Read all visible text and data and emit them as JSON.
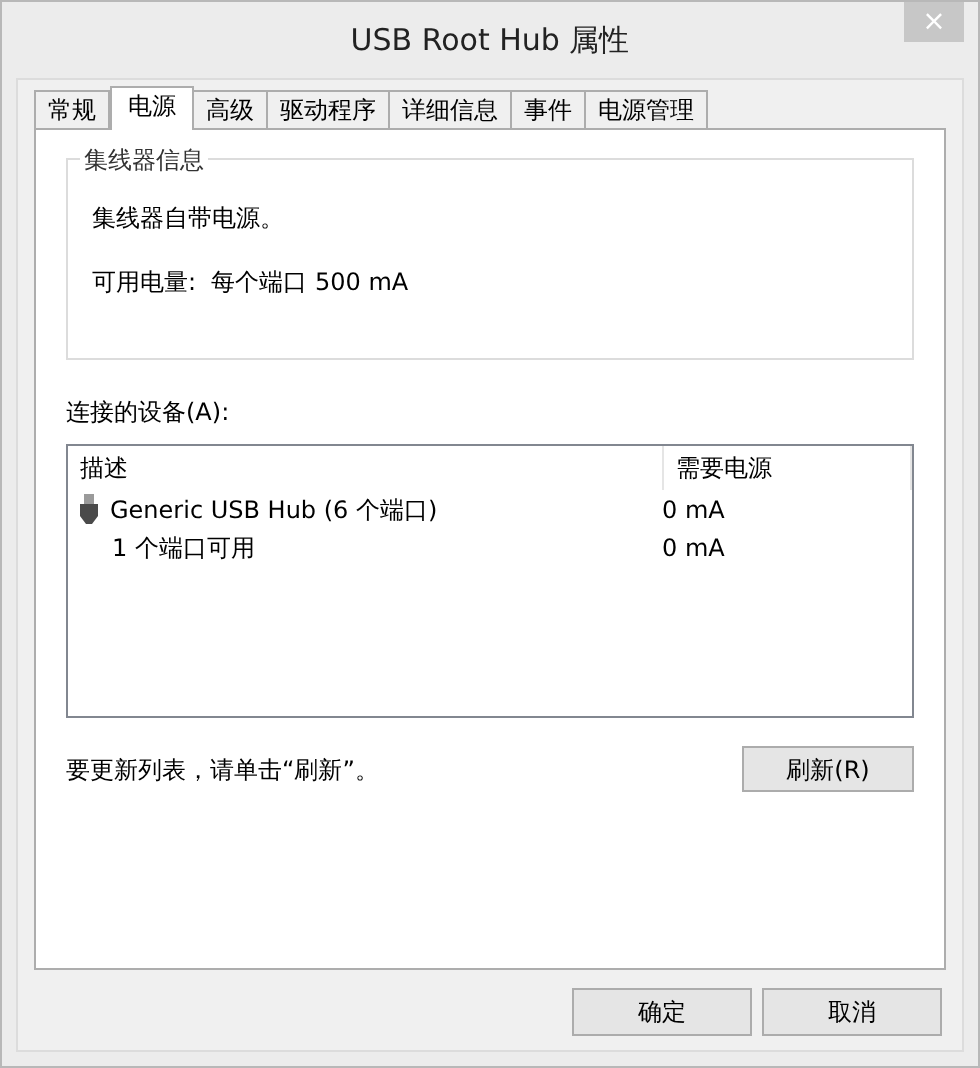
{
  "window": {
    "title": "USB Root Hub 属性",
    "close": "×"
  },
  "tabs": [
    {
      "label": "常规",
      "selected": false
    },
    {
      "label": "电源",
      "selected": true
    },
    {
      "label": "高级",
      "selected": false
    },
    {
      "label": "驱动程序",
      "selected": false
    },
    {
      "label": "详细信息",
      "selected": false
    },
    {
      "label": "事件",
      "selected": false
    },
    {
      "label": "电源管理",
      "selected": false
    }
  ],
  "hub_info": {
    "title": "集线器信息",
    "lines": [
      "集线器自带电源。",
      "可用电量:  每个端口 500 mA"
    ]
  },
  "devices": {
    "label": "连接的设备(A):",
    "columns": [
      "描述",
      "需要电源"
    ],
    "rows": [
      {
        "name": "Generic USB Hub (6 个端口)",
        "power": "0 mA",
        "children": [
          {
            "name": "1 个端口可用",
            "power": "0 mA"
          }
        ]
      }
    ]
  },
  "refresh_hint": "要更新列表，请单击“刷新”。",
  "refresh_button": "刷新(R)",
  "buttons": [
    "确定",
    "取消"
  ]
}
